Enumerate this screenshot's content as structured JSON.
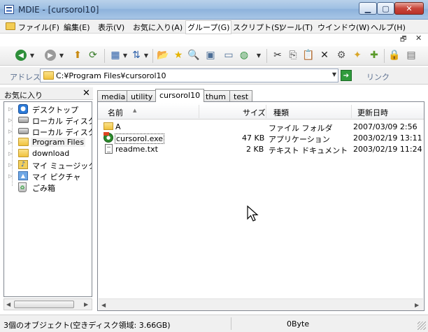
{
  "window": {
    "title": "MDIE - [cursorol10]",
    "min_symbol": "▁",
    "max_symbol": "▢",
    "close_symbol": "✕"
  },
  "menu": [
    {
      "label": "ファイル(F)"
    },
    {
      "label": "編集(E)"
    },
    {
      "label": "表示(V)"
    },
    {
      "label": "お気に入り(A)"
    },
    {
      "label": "グループ(G)"
    },
    {
      "label": "スクリプト(S)"
    },
    {
      "label": "ツール(T)"
    },
    {
      "label": "ウインドウ(W)"
    },
    {
      "label": "ヘルプ(H)"
    }
  ],
  "mdi": {
    "restore_symbol": "🗗",
    "close_symbol": "✕"
  },
  "address": {
    "label": "アドレス",
    "value": "C:¥Program Files¥cursorol10",
    "go_symbol": "➔",
    "links_label": "リンク"
  },
  "left_panel": {
    "title": "お気に入り",
    "close_symbol": "✕",
    "items": [
      {
        "label": "デスクトップ",
        "icon": "desktop-icon"
      },
      {
        "label": "ローカル ディスク (",
        "icon": "drive-icon"
      },
      {
        "label": "ローカル ディスク (",
        "icon": "drive-icon"
      },
      {
        "label": "Program Files",
        "icon": "folder-icon"
      },
      {
        "label": "download",
        "icon": "folder-icon"
      },
      {
        "label": "マイ ミュージック",
        "icon": "music-folder-icon"
      },
      {
        "label": "マイ ピクチャ",
        "icon": "pictures-folder-icon"
      },
      {
        "label": "ごみ箱",
        "icon": "recycle-bin-icon"
      }
    ]
  },
  "tabs": [
    {
      "label": "media"
    },
    {
      "label": "utility"
    },
    {
      "label": "cursorol10"
    },
    {
      "label": "thum"
    },
    {
      "label": "test"
    }
  ],
  "active_tab": "cursorol10",
  "file_list": {
    "columns": [
      "名前",
      "サイズ",
      "種類",
      "更新日時"
    ],
    "rows": [
      {
        "name": "A",
        "size": "",
        "type": "ファイル フォルダ",
        "modified": "2007/03/09 2:56",
        "icon": "folder-icon"
      },
      {
        "name": "cursorol.exe",
        "size": "47 KB",
        "type": "アプリケーション",
        "modified": "2003/02/19 13:11",
        "icon": "exe-icon"
      },
      {
        "name": "readme.txt",
        "size": "2 KB",
        "type": "テキスト ドキュメント",
        "modified": "2003/02/19 11:24",
        "icon": "text-file-icon"
      }
    ]
  },
  "status": {
    "left": "3個のオブジェクト(空きディスク領域: 3.66GB)",
    "right": "0Byte"
  }
}
